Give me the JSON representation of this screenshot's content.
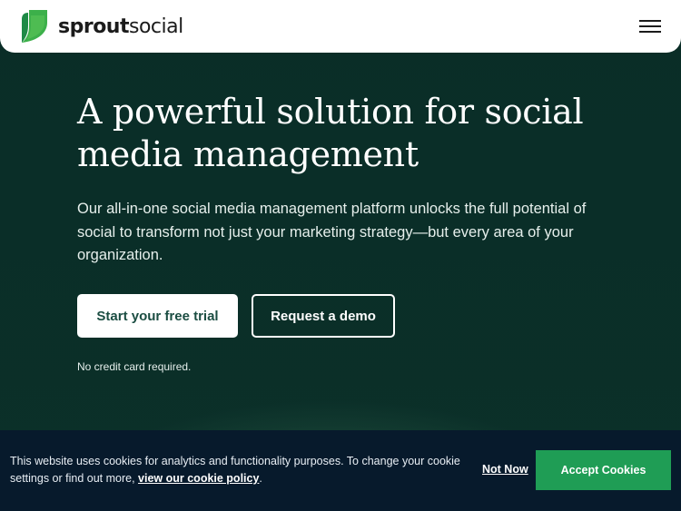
{
  "header": {
    "logo_bold": "sprout",
    "logo_light": "social",
    "logo_icon": "sprout-leaf-icon",
    "menu_icon": "hamburger-menu-icon"
  },
  "hero": {
    "title": "A powerful solution for social media management",
    "subtitle": "Our all-in-one social media management platform unlocks the full potential of social to transform not just your marketing strategy—but every area of your organization.",
    "primary_button": "Start your free trial",
    "secondary_button": "Request a demo",
    "note": "No credit card required."
  },
  "cookie": {
    "text": "This website uses cookies for analytics and functionality purposes. To change your cookie settings or find out more, ",
    "link": "view our cookie policy",
    "text_end": ".",
    "not_now": "Not Now",
    "accept": "Accept Cookies"
  },
  "colors": {
    "hero_bg": "#0b2e28",
    "cookie_bg": "#071a2c",
    "accept_green": "#1f9d55",
    "logo_green": "#3cb04a"
  }
}
